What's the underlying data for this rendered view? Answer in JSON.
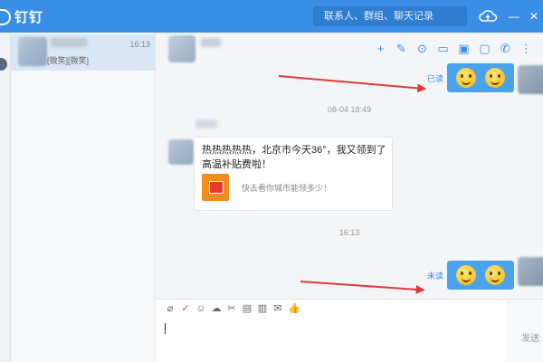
{
  "app": {
    "name": "钉钉"
  },
  "search": {
    "placeholder": "联系人、群组、聊天记录"
  },
  "conversation": {
    "time": "16:13",
    "preview": "[微笑][微笑]"
  },
  "messages": {
    "read_status": "已读",
    "timestamp1": "08-04 18:49",
    "card_text": "热热热热热，北京市今天36°，我又领到了高温补贴费啦！",
    "card_link": "快去看你城市能领多少！",
    "timestamp2": "16:13",
    "unread_status": "未读"
  },
  "send": {
    "label": "发送"
  },
  "colors": {
    "brand": "#3a8ee6",
    "bubble": "#4aa3ee",
    "arrow": "#e03a3a"
  }
}
